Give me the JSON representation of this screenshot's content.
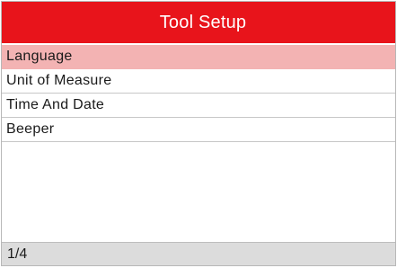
{
  "header": {
    "title": "Tool Setup"
  },
  "menu": {
    "items": [
      {
        "label": "Language",
        "selected": true
      },
      {
        "label": "Unit of Measure",
        "selected": false
      },
      {
        "label": "Time And Date",
        "selected": false
      },
      {
        "label": "Beeper",
        "selected": false
      }
    ]
  },
  "footer": {
    "page_indicator": "1/4"
  },
  "colors": {
    "title_bar": "#e8141b",
    "selection": "#f3b3b3",
    "status_bar": "#dcdcdc"
  }
}
